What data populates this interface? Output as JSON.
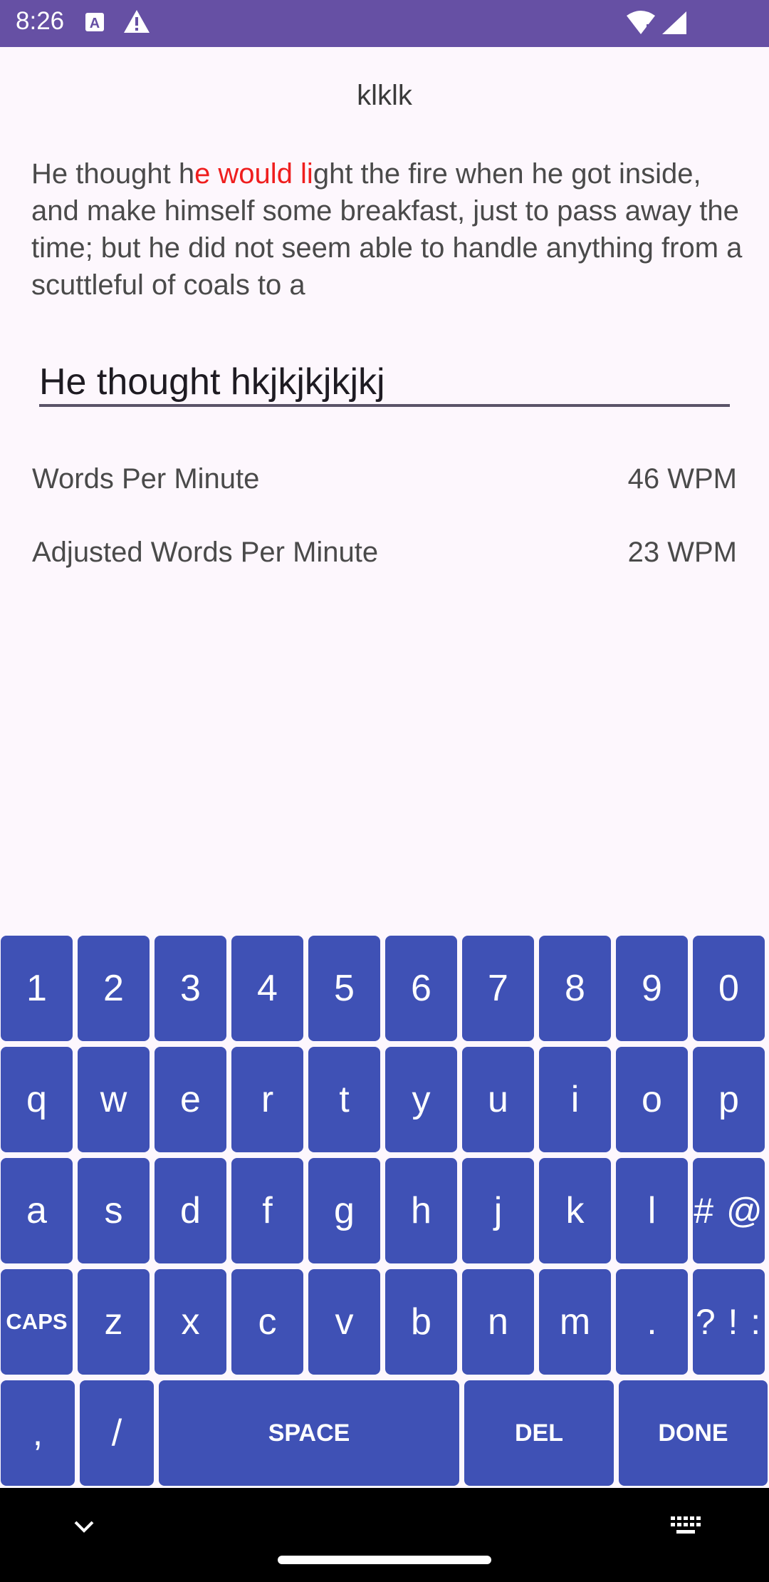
{
  "status_bar": {
    "time": "8:26",
    "icons": [
      "a-icon",
      "warning-icon",
      "wifi-icon",
      "signal-icon"
    ],
    "color": "#6650a4"
  },
  "title": "klklk",
  "passage": {
    "before": "He thought h",
    "error": "e would li",
    "after": "ght the fire when he got inside, and make himself some breakfast, just to pass away the time; but he did not seem able to handle anything from a scuttleful of coals to a"
  },
  "typing_input": {
    "value": "He thought hkjkjkjkjkj"
  },
  "stats": [
    {
      "label": "Words Per Minute",
      "value": "46 WPM"
    },
    {
      "label": "Adjusted Words Per Minute",
      "value": "23 WPM"
    }
  ],
  "keyboard": {
    "rows": [
      [
        "1",
        "2",
        "3",
        "4",
        "5",
        "6",
        "7",
        "8",
        "9",
        "0"
      ],
      [
        "q",
        "w",
        "e",
        "r",
        "t",
        "y",
        "u",
        "i",
        "o",
        "p"
      ],
      [
        "a",
        "s",
        "d",
        "f",
        "g",
        "h",
        "j",
        "k",
        "l",
        "# @"
      ],
      [
        "CAPS",
        "z",
        "x",
        "c",
        "v",
        "b",
        "n",
        "m",
        ".",
        "? ! :"
      ],
      [
        ",",
        "/",
        "SPACE",
        "DEL",
        "DONE"
      ]
    ],
    "key_color": "#3f51b5"
  },
  "colors": {
    "error_text": "#ef1e1e",
    "background": "#fdf7fd"
  }
}
